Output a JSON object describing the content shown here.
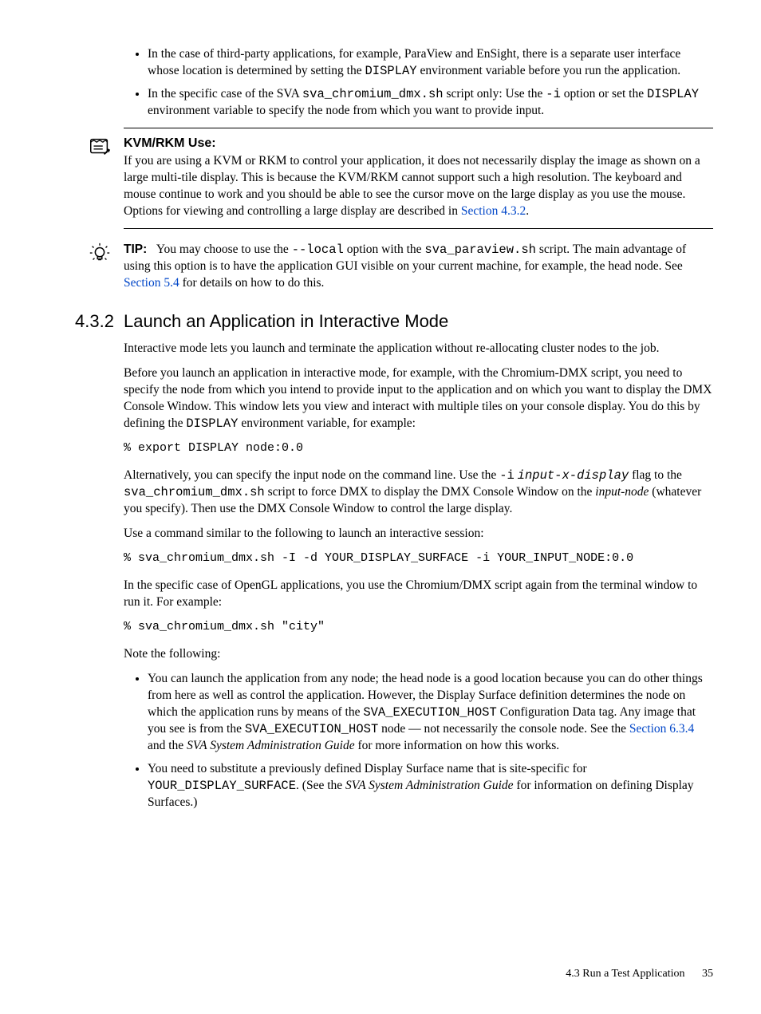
{
  "bullets_top": [
    {
      "pre": "In the case of third-party applications, for example, ParaView and EnSight, there is a separate user interface whose location is determined by setting the ",
      "code1": "DISPLAY",
      "post1": " environment variable before you run the application."
    },
    {
      "pre": "In the specific case of the SVA ",
      "code1": "sva_chromium_dmx.sh",
      "mid1": " script only: Use the ",
      "code2": "-i",
      "mid2": " option or set the ",
      "code3": "DISPLAY",
      "post": " environment variable to specify the node from which you want to provide input."
    }
  ],
  "kvm": {
    "heading": "KVM/RKM Use:",
    "body_pre": "If you are using a KVM or RKM to control your application, it does not necessarily display the image as shown on a large multi-tile display. This is because the KVM/RKM cannot support such a high resolution. The keyboard and mouse continue to work and you should be able to see the cursor move on the large display as you use the mouse. Options for viewing and controlling a large display are described in ",
    "link": "Section 4.3.2",
    "body_post": "."
  },
  "tip": {
    "label": "TIP:",
    "pre": "You may choose to use the ",
    "code1": "--local",
    "mid1": " option with the ",
    "code2": "sva_paraview.sh",
    "mid2": " script. The main advantage of using this option is to have the application GUI visible on your current machine, for example, the head node. See ",
    "link": "Section 5.4",
    "post": " for details on how to do this."
  },
  "section": {
    "num": "4.3.2",
    "title": "Launch an Application in Interactive Mode"
  },
  "p1": "Interactive mode lets you launch and terminate the application without re-allocating cluster nodes to the job.",
  "p2": {
    "pre": "Before you launch an application in interactive mode, for example, with the Chromium-DMX script, you need to specify the node from which you intend to provide input to the application and on which you want to display the DMX Console Window. This window lets you view and interact with multiple tiles on your console display. You do this by defining the ",
    "code": "DISPLAY",
    "post": " environment variable, for example:"
  },
  "cmd1": "% export DISPLAY node:0.0",
  "p3": {
    "pre": "Alternatively, you can specify the input node on the command line. Use the ",
    "code1": "-i",
    "nl": " ",
    "ital": "input-x-display",
    "mid1": " flag to the ",
    "code2": "sva_chromium_dmx.sh",
    "mid2": " script to force DMX to display the DMX Console Window on the ",
    "ital2": "input-node",
    "post": " (whatever you specify). Then use the DMX Console Window to control the large display."
  },
  "p4": "Use a command similar to the following to launch an interactive session:",
  "cmd2": "% sva_chromium_dmx.sh -I -d YOUR_DISPLAY_SURFACE -i YOUR_INPUT_NODE:0.0",
  "p5": "In the specific case of OpenGL applications, you use the Chromium/DMX script again from the terminal window to run it. For example:",
  "cmd3": "% sva_chromium_dmx.sh \"city\"",
  "p6": "Note the following:",
  "bullets_bottom": [
    {
      "pre": "You can launch the application from any node; the head node is a good location because you can do other things from here as well as control the application. However, the Display Surface definition determines the node on which the application runs by means of the ",
      "code1": "SVA_EXECUTION_HOST",
      "mid1": " Configuration Data tag. Any image that you see is from the ",
      "code2": "SVA_EXECUTION_HOST",
      "mid2": " node — not necessarily the console node. See the ",
      "link": "Section 6.3.4",
      "mid3": " and the ",
      "ital": "SVA System Administration Guide",
      "post": " for more information on how this works."
    },
    {
      "pre": "You need to substitute a previously defined Display Surface name that is site-specific for ",
      "code1": "YOUR_DISPLAY_SURFACE",
      "mid1": ". (See the ",
      "ital": "SVA System Administration Guide",
      "post": " for information on defining Display Surfaces.)"
    }
  ],
  "footer": {
    "section": "4.3 Run a Test Application",
    "page": "35"
  }
}
